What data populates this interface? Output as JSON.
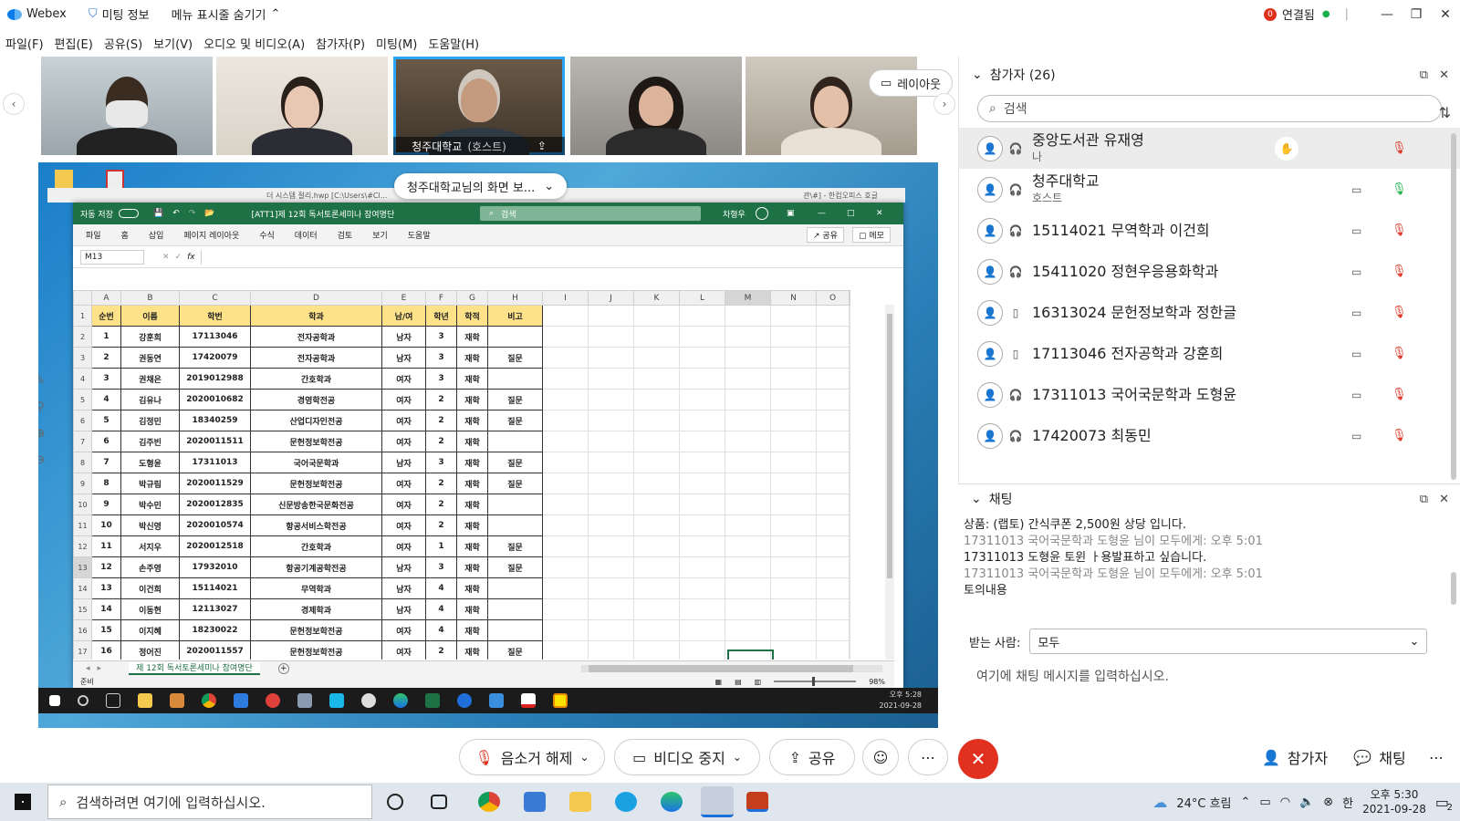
{
  "titlebar": {
    "app_name": "Webex",
    "meeting_info": "미팅 정보",
    "hide_menu": "메뉴 표시줄 숨기기",
    "status": "연결됨",
    "status_icon_label": "0"
  },
  "menu": [
    "파일(F)",
    "편집(E)",
    "공유(S)",
    "보기(V)",
    "오디오 및 비디오(A)",
    "참가자(P)",
    "미팅(M)",
    "도움말(H)"
  ],
  "video": {
    "active_label": "청주대학교",
    "active_role": "(호스트)",
    "layout_button": "레이아웃"
  },
  "share_banner": "청주대학교님의 화면 보...",
  "excel": {
    "title_doc": "[ATT1]제 12회 독서토론세미나 참여명단",
    "autosave": "자동 저장",
    "search": "검색",
    "user": "차형우",
    "background_title": "더 시스템 절리.hwp [C:\\Users\\#Cl...",
    "background_title2": "관\\#] - 한컴오피스 호글",
    "ribbon": [
      "파일",
      "홈",
      "삽입",
      "페이지 레이아웃",
      "수식",
      "데이터",
      "검토",
      "보기",
      "도움말"
    ],
    "share": "공유",
    "memo": "메모",
    "namebox": "M13",
    "fx": "fx",
    "columns": [
      "A",
      "B",
      "C",
      "D",
      "E",
      "F",
      "G",
      "H",
      "I",
      "J",
      "K",
      "L",
      "M",
      "N",
      "O"
    ],
    "header": [
      "순번",
      "이름",
      "학번",
      "학과",
      "남/여",
      "학년",
      "학적",
      "비고"
    ],
    "rows": [
      [
        "1",
        "강훈희",
        "17113046",
        "전자공학과",
        "남자",
        "3",
        "재학",
        ""
      ],
      [
        "2",
        "권동연",
        "17420079",
        "전자공학과",
        "남자",
        "3",
        "재학",
        "질문"
      ],
      [
        "3",
        "권채은",
        "2019012988",
        "간호학과",
        "여자",
        "3",
        "재학",
        ""
      ],
      [
        "4",
        "김유나",
        "2020010682",
        "경영학전공",
        "여자",
        "2",
        "재학",
        "질문"
      ],
      [
        "5",
        "김정민",
        "18340259",
        "산업디자인전공",
        "여자",
        "2",
        "재학",
        "질문"
      ],
      [
        "6",
        "김주빈",
        "2020011511",
        "문헌정보학전공",
        "여자",
        "2",
        "재학",
        ""
      ],
      [
        "7",
        "도형윤",
        "17311013",
        "국어국문학과",
        "남자",
        "3",
        "재학",
        "질문"
      ],
      [
        "8",
        "박규림",
        "2020011529",
        "문헌정보학전공",
        "여자",
        "2",
        "재학",
        "질문"
      ],
      [
        "9",
        "박수민",
        "2020012835",
        "신문방송한국문화전공",
        "여자",
        "2",
        "재학",
        ""
      ],
      [
        "10",
        "박신영",
        "2020010574",
        "항공서비스학전공",
        "여자",
        "2",
        "재학",
        ""
      ],
      [
        "11",
        "서지우",
        "2020012518",
        "간호학과",
        "여자",
        "1",
        "재학",
        "질문"
      ],
      [
        "12",
        "손주영",
        "17932010",
        "항공기계공학전공",
        "남자",
        "3",
        "재학",
        "질문"
      ],
      [
        "13",
        "이건희",
        "15114021",
        "무역학과",
        "남자",
        "4",
        "재학",
        ""
      ],
      [
        "14",
        "이동현",
        "12113027",
        "경제학과",
        "남자",
        "4",
        "재학",
        ""
      ],
      [
        "15",
        "이지혜",
        "18230022",
        "문헌정보학전공",
        "여자",
        "4",
        "재학",
        ""
      ],
      [
        "16",
        "정어진",
        "2020011557",
        "문헌정보학전공",
        "여자",
        "2",
        "재학",
        "질문"
      ]
    ],
    "sheet_tab": "제 12회 독서토론세미나 참여명단",
    "status_ready": "준비",
    "zoom": "98%",
    "clock_time": "오후 5:28",
    "clock_date": "2021-09-28"
  },
  "participants": {
    "title": "참가자 (26)",
    "search_placeholder": "검색",
    "list": [
      {
        "name": "중앙도서관 유재영",
        "role": "나"
      },
      {
        "name": "청주대학교",
        "role": "호스트"
      },
      {
        "name": "15114021 무역학과 이건희",
        "role": ""
      },
      {
        "name": "15411020 정현우응용화학과",
        "role": ""
      },
      {
        "name": "16313024 문헌정보학과 정한글",
        "role": ""
      },
      {
        "name": "17113046 전자공학과 강훈희",
        "role": ""
      },
      {
        "name": "17311013 국어국문학과 도형윤",
        "role": ""
      },
      {
        "name": "17420073 최동민",
        "role": ""
      }
    ]
  },
  "chat": {
    "title": "채팅",
    "messages": [
      {
        "meta": "",
        "text": "상품: (랩토) 간식쿠폰 2,500원 상당 입니다."
      },
      {
        "meta": "17311013 국어국문학과 도형윤 님이 모두에게:    오후 5:01",
        "text": "17311013 도형윤 토윈 ㅏ용발표하고 싶습니다."
      },
      {
        "meta": "17311013 국어국문학과 도형윤 님이 모두에게:    오후 5:01",
        "text": "토의내용"
      }
    ],
    "to_label": "받는 사람:",
    "to_value": "모두",
    "input_placeholder": "여기에 채팅 메시지를 입력하십시오."
  },
  "controls": {
    "unmute": "음소거 해제",
    "stop_video": "비디오 중지",
    "share": "공유",
    "participants": "참가자",
    "chat": "채팅"
  },
  "taskbar": {
    "search_placeholder": "검색하려면 여기에 입력하십시오.",
    "weather": "24°C  흐림",
    "ime": "한",
    "time": "오후 5:30",
    "date": "2021-09-28",
    "notif": "2"
  },
  "colors": {
    "excel_green": "#1e7145",
    "header_yellow": "#fde28a",
    "end_red": "#e0301e",
    "active_blue": "#2ba5f5"
  }
}
